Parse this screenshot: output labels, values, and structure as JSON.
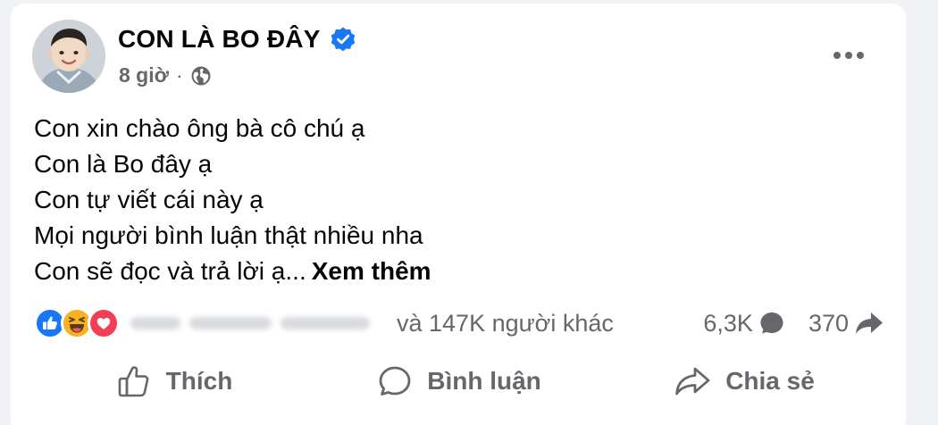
{
  "post": {
    "author_name": "CON LÀ BO ĐÂY",
    "verified_icon": "verified-badge-icon",
    "time": "8 giờ",
    "separator": "·",
    "audience_icon": "globe-icon",
    "more_icon": "more-options-icon",
    "text_lines": [
      "Con xin chào ông bà cô chú ạ",
      "Con là Bo đây ạ",
      "Con tự viết cái này ạ",
      "Mọi người bình luận thật nhiều nha",
      "Con sẽ đọc và trả lời ạ..."
    ],
    "see_more_label": "Xem thêm"
  },
  "reactions": {
    "icons": [
      "like-reaction-icon",
      "haha-reaction-icon",
      "love-reaction-icon"
    ],
    "others_text": "và 147K người khác",
    "comments_count": "6,3K",
    "shares_count": "370"
  },
  "actions": {
    "like_label": "Thích",
    "comment_label": "Bình luận",
    "share_label": "Chia sẻ"
  },
  "colors": {
    "verified": "#1877f2",
    "like": "#1877f2",
    "haha": "#f7b125",
    "love": "#f33e58",
    "secondary_text": "#65676b"
  }
}
